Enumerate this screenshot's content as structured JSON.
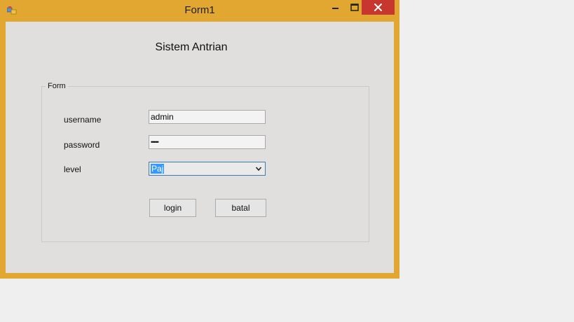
{
  "window": {
    "title": "Form1",
    "icon": "form-app-icon",
    "controls": {
      "minimize": "minimize-icon",
      "maximize": "maximize-icon",
      "close": "close-icon"
    },
    "frame_color": "#e2a731",
    "close_color": "#c7372f"
  },
  "form": {
    "heading": "Sistem Antrian",
    "group_label": "Form",
    "fields": {
      "username": {
        "label": "username",
        "value": "admin"
      },
      "password": {
        "label": "password",
        "value": "•••••"
      },
      "level": {
        "label": "level",
        "value": "Paj",
        "dropdown_icon": "chevron-down-icon"
      }
    },
    "buttons": {
      "login": "login",
      "batal": "batal"
    }
  }
}
